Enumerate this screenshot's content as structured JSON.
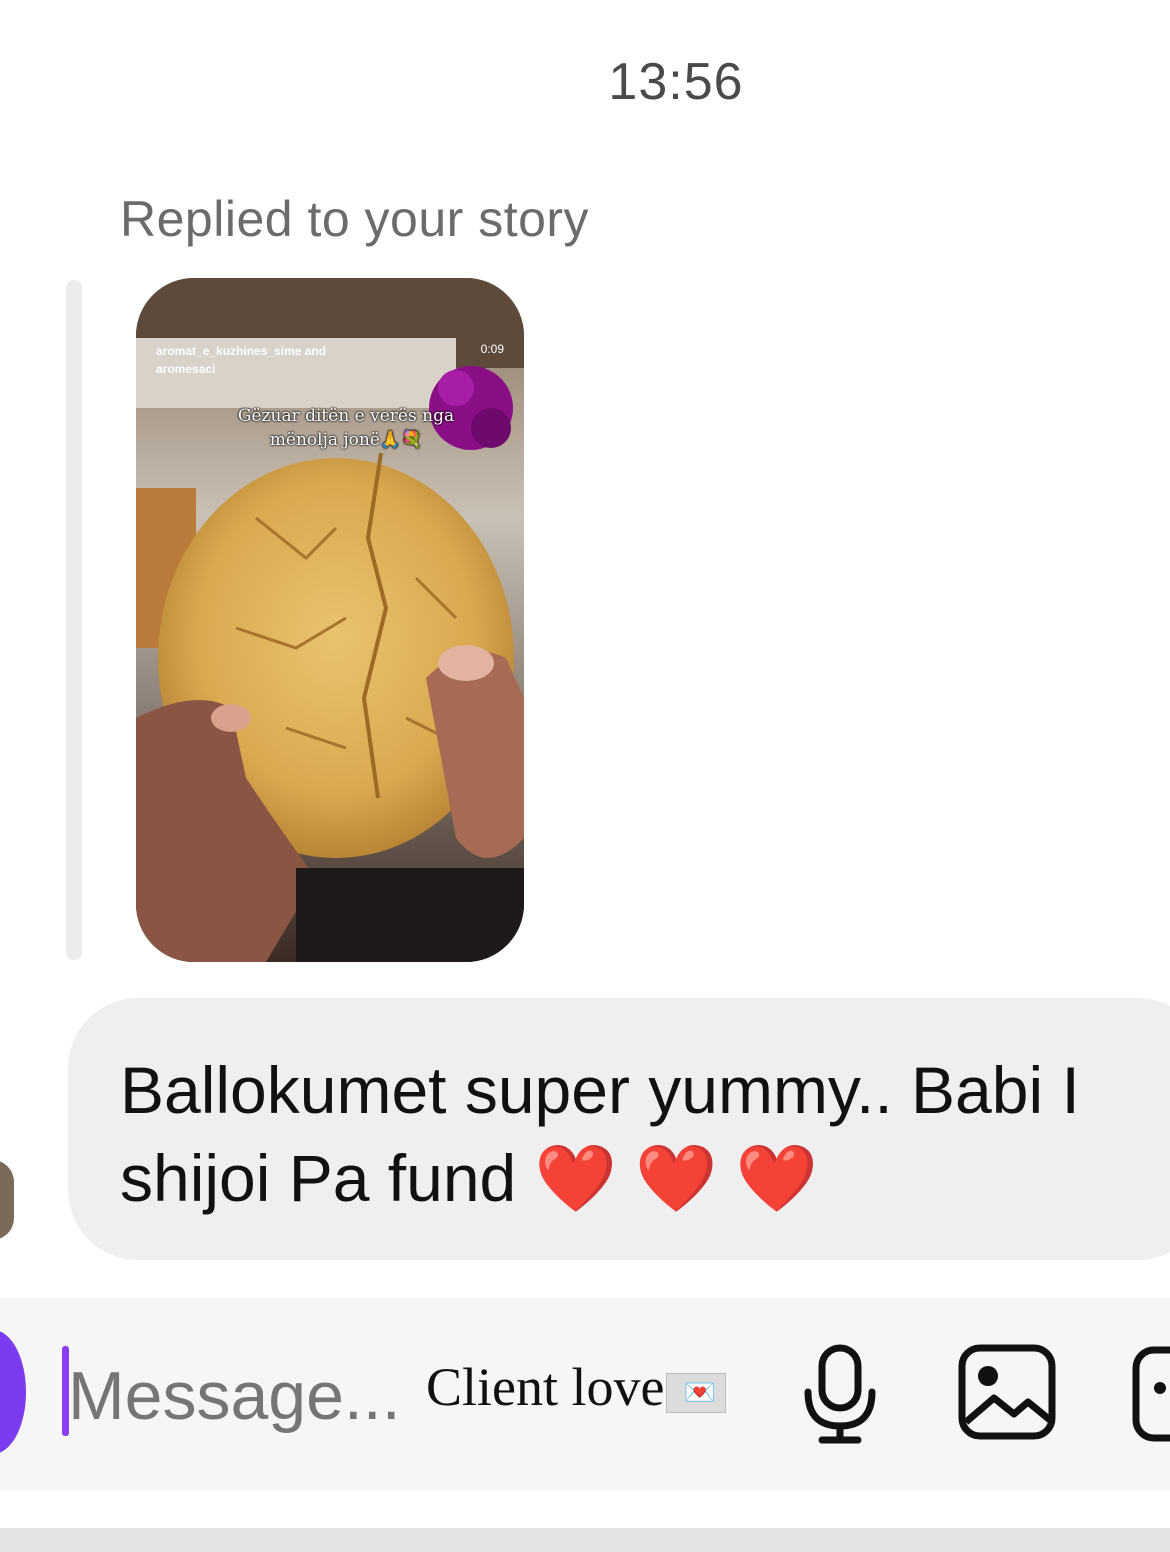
{
  "thread": {
    "timestamp": "13:56",
    "reply_label": "Replied to your story"
  },
  "story": {
    "username_line1": "aromat_e_kuzhines_sime and",
    "username_line2": "aromesaci",
    "duration": "0:09",
    "caption_line1": "Gëzuar ditën e verës nga",
    "caption_line2": "mënolja jonë🙏💐"
  },
  "message": {
    "line1": "Ballokumet super yummy.. Babi I",
    "line2_text": "shijoi Pa fund",
    "hearts": [
      "❤️",
      "❤️",
      "❤️"
    ]
  },
  "composer": {
    "placeholder": "Message...",
    "overlay_text": "Client love",
    "overlay_emoji": "💌",
    "icons": [
      "camera-icon",
      "microphone-icon",
      "gallery-icon",
      "sticker-icon"
    ]
  },
  "colors": {
    "accent": "#8a3cf0",
    "bubble": "#efefef",
    "heart": "#e8152a"
  }
}
